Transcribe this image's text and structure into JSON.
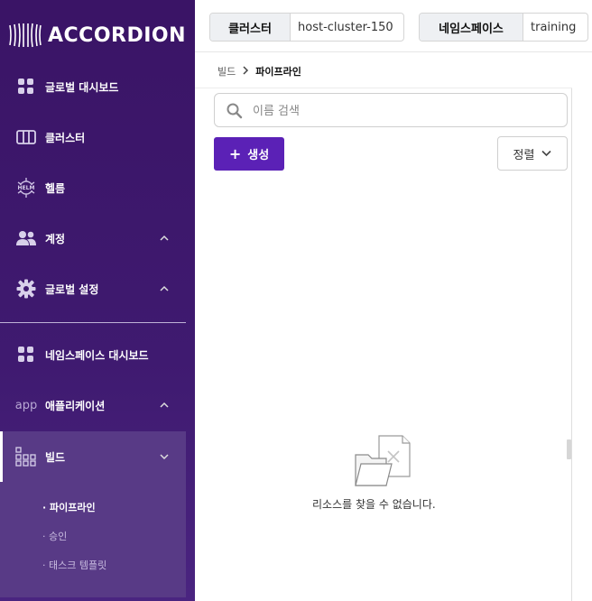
{
  "app": {
    "logo_text": "ACCORDION"
  },
  "sidebar": {
    "items": [
      {
        "label": "글로벌 대시보드",
        "icon": "dashboard-icon"
      },
      {
        "label": "클러스터",
        "icon": "cluster-icon"
      },
      {
        "label": "헬름",
        "icon": "helm-icon"
      },
      {
        "label": "계정",
        "icon": "users-icon"
      },
      {
        "label": "글로벌 설정",
        "icon": "gear-icon"
      },
      {
        "label": "네임스페이스 대시보드",
        "icon": "dashboard-icon"
      },
      {
        "label": "애플리케이션",
        "icon": "app-icon",
        "icon_text": "app"
      },
      {
        "label": "빌드",
        "icon": "build-icon"
      }
    ],
    "build_subitems": [
      {
        "label": "· 파이프라인",
        "active": true
      },
      {
        "label": "· 승인"
      },
      {
        "label": "· 태스크 템플릿"
      }
    ]
  },
  "topbar": {
    "cluster_key": "클러스터",
    "cluster_value": "host-cluster-150",
    "namespace_key": "네임스페이스",
    "namespace_value": "training"
  },
  "breadcrumb": {
    "parent": "빌드",
    "current": "파이프라인"
  },
  "search": {
    "placeholder": "이름 검색",
    "value": ""
  },
  "toolbar": {
    "create_label": "생성",
    "sort_label": "정렬"
  },
  "empty_state": {
    "message": "리소스를 찾을 수 없습니다."
  },
  "colors": {
    "sidebar_bg": "#3a1466",
    "accent": "#5b21b6",
    "submenu_bg": "#583a86"
  }
}
